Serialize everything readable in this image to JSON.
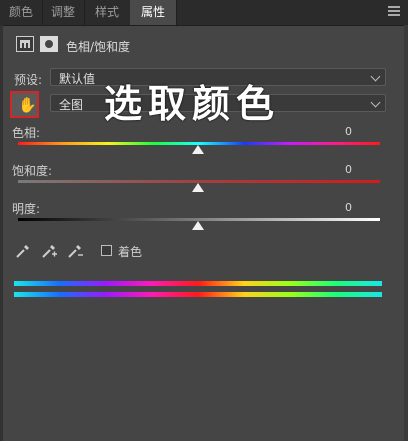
{
  "tabs": [
    {
      "label": "颜色"
    },
    {
      "label": "调整"
    },
    {
      "label": "样式"
    },
    {
      "label": "属性"
    }
  ],
  "header": {
    "title": "色相/饱和度"
  },
  "preset": {
    "label": "预设:",
    "value": "默认值"
  },
  "channel": {
    "value": "全图"
  },
  "overlay": {
    "text": "选取颜色"
  },
  "hue": {
    "label": "色相:",
    "value": "0",
    "level_fraction": 0.5
  },
  "saturation": {
    "label": "饱和度:",
    "value": "0",
    "level_fraction": 0.5
  },
  "lightness": {
    "label": "明度:",
    "value": "0",
    "level_fraction": 0.5
  },
  "colorize": {
    "label": "着色",
    "checked": false
  },
  "icons": {
    "menu": "menu-icon",
    "adjustment": "hue-saturation-adjustment-icon",
    "mask": "layer-mask-icon",
    "hand": "on-image-adjustment-hand-icon",
    "eyedropper": "eyedropper-icon",
    "eyedropper_add": "eyedropper-add-icon",
    "eyedropper_subtract": "eyedropper-subtract-icon"
  },
  "colors": {
    "panel_bg": "#454545",
    "tab_bar_bg": "#2b2b2b",
    "highlight_box": "#d42626"
  }
}
